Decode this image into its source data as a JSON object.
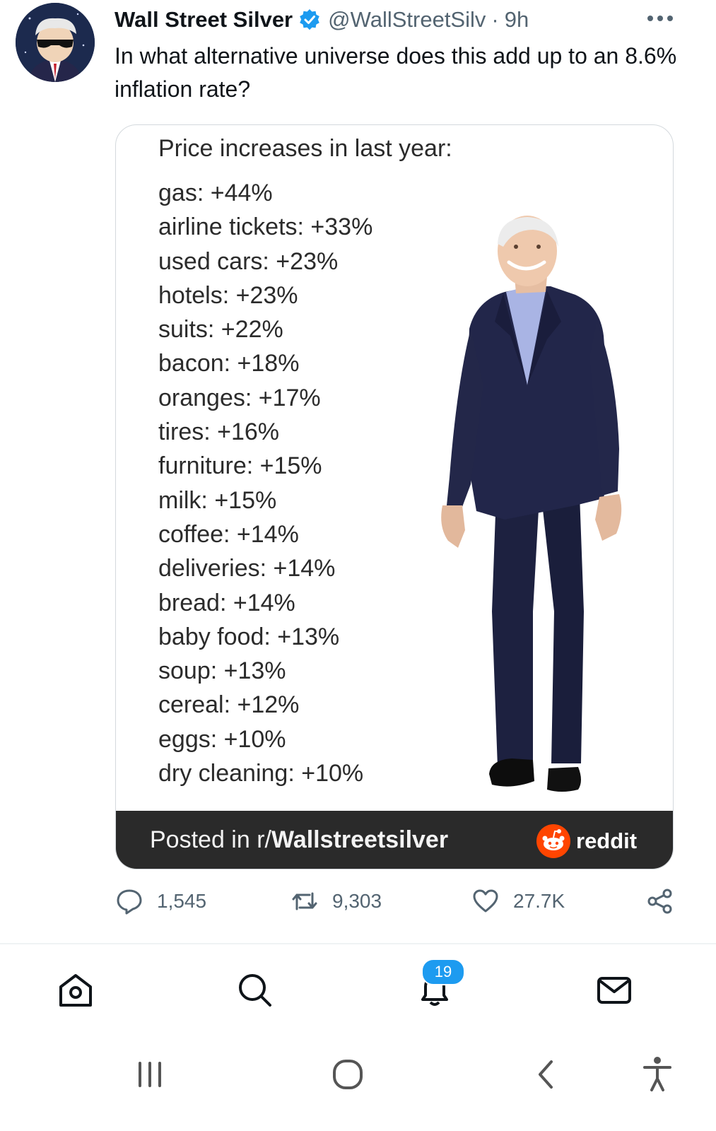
{
  "tweet": {
    "author_name": "Wall Street Silver",
    "handle": "@WallStreetSilv",
    "separator": "·",
    "time": "9h",
    "text": "In what alternative universe does this add up to an 8.6% inflation rate?",
    "avatar_icon": "masked-figure-avatar",
    "verified_icon": "verified-badge-icon",
    "more_icon": "more-dots-icon"
  },
  "card": {
    "heading": "Price increases in last year:",
    "items": [
      "gas: +44%",
      "airline tickets: +33%",
      "used cars: +23%",
      "hotels: +23%",
      "suits: +22%",
      "bacon: +18%",
      "oranges: +17%",
      "tires: +16%",
      "furniture: +15%",
      "milk: +15%",
      "coffee: +14%",
      "deliveries: +14%",
      "bread: +14%",
      "baby food: +13%",
      "soup: +13%",
      "cereal: +12%",
      "eggs: +10%",
      "dry cleaning: +10%"
    ],
    "footer_prefix": "Posted in r/",
    "footer_subreddit": "Wallstreetsilver",
    "footer_brand": "reddit"
  },
  "actions": {
    "replies": "1,545",
    "retweets": "9,303",
    "likes": "27.7K"
  },
  "tabbar": {
    "notifications_badge": "19"
  },
  "colors": {
    "accent": "#1d9bf0",
    "text": "#0f1419",
    "muted": "#536471",
    "card_footer": "#2a2a2a",
    "reddit": "#ff4500"
  }
}
